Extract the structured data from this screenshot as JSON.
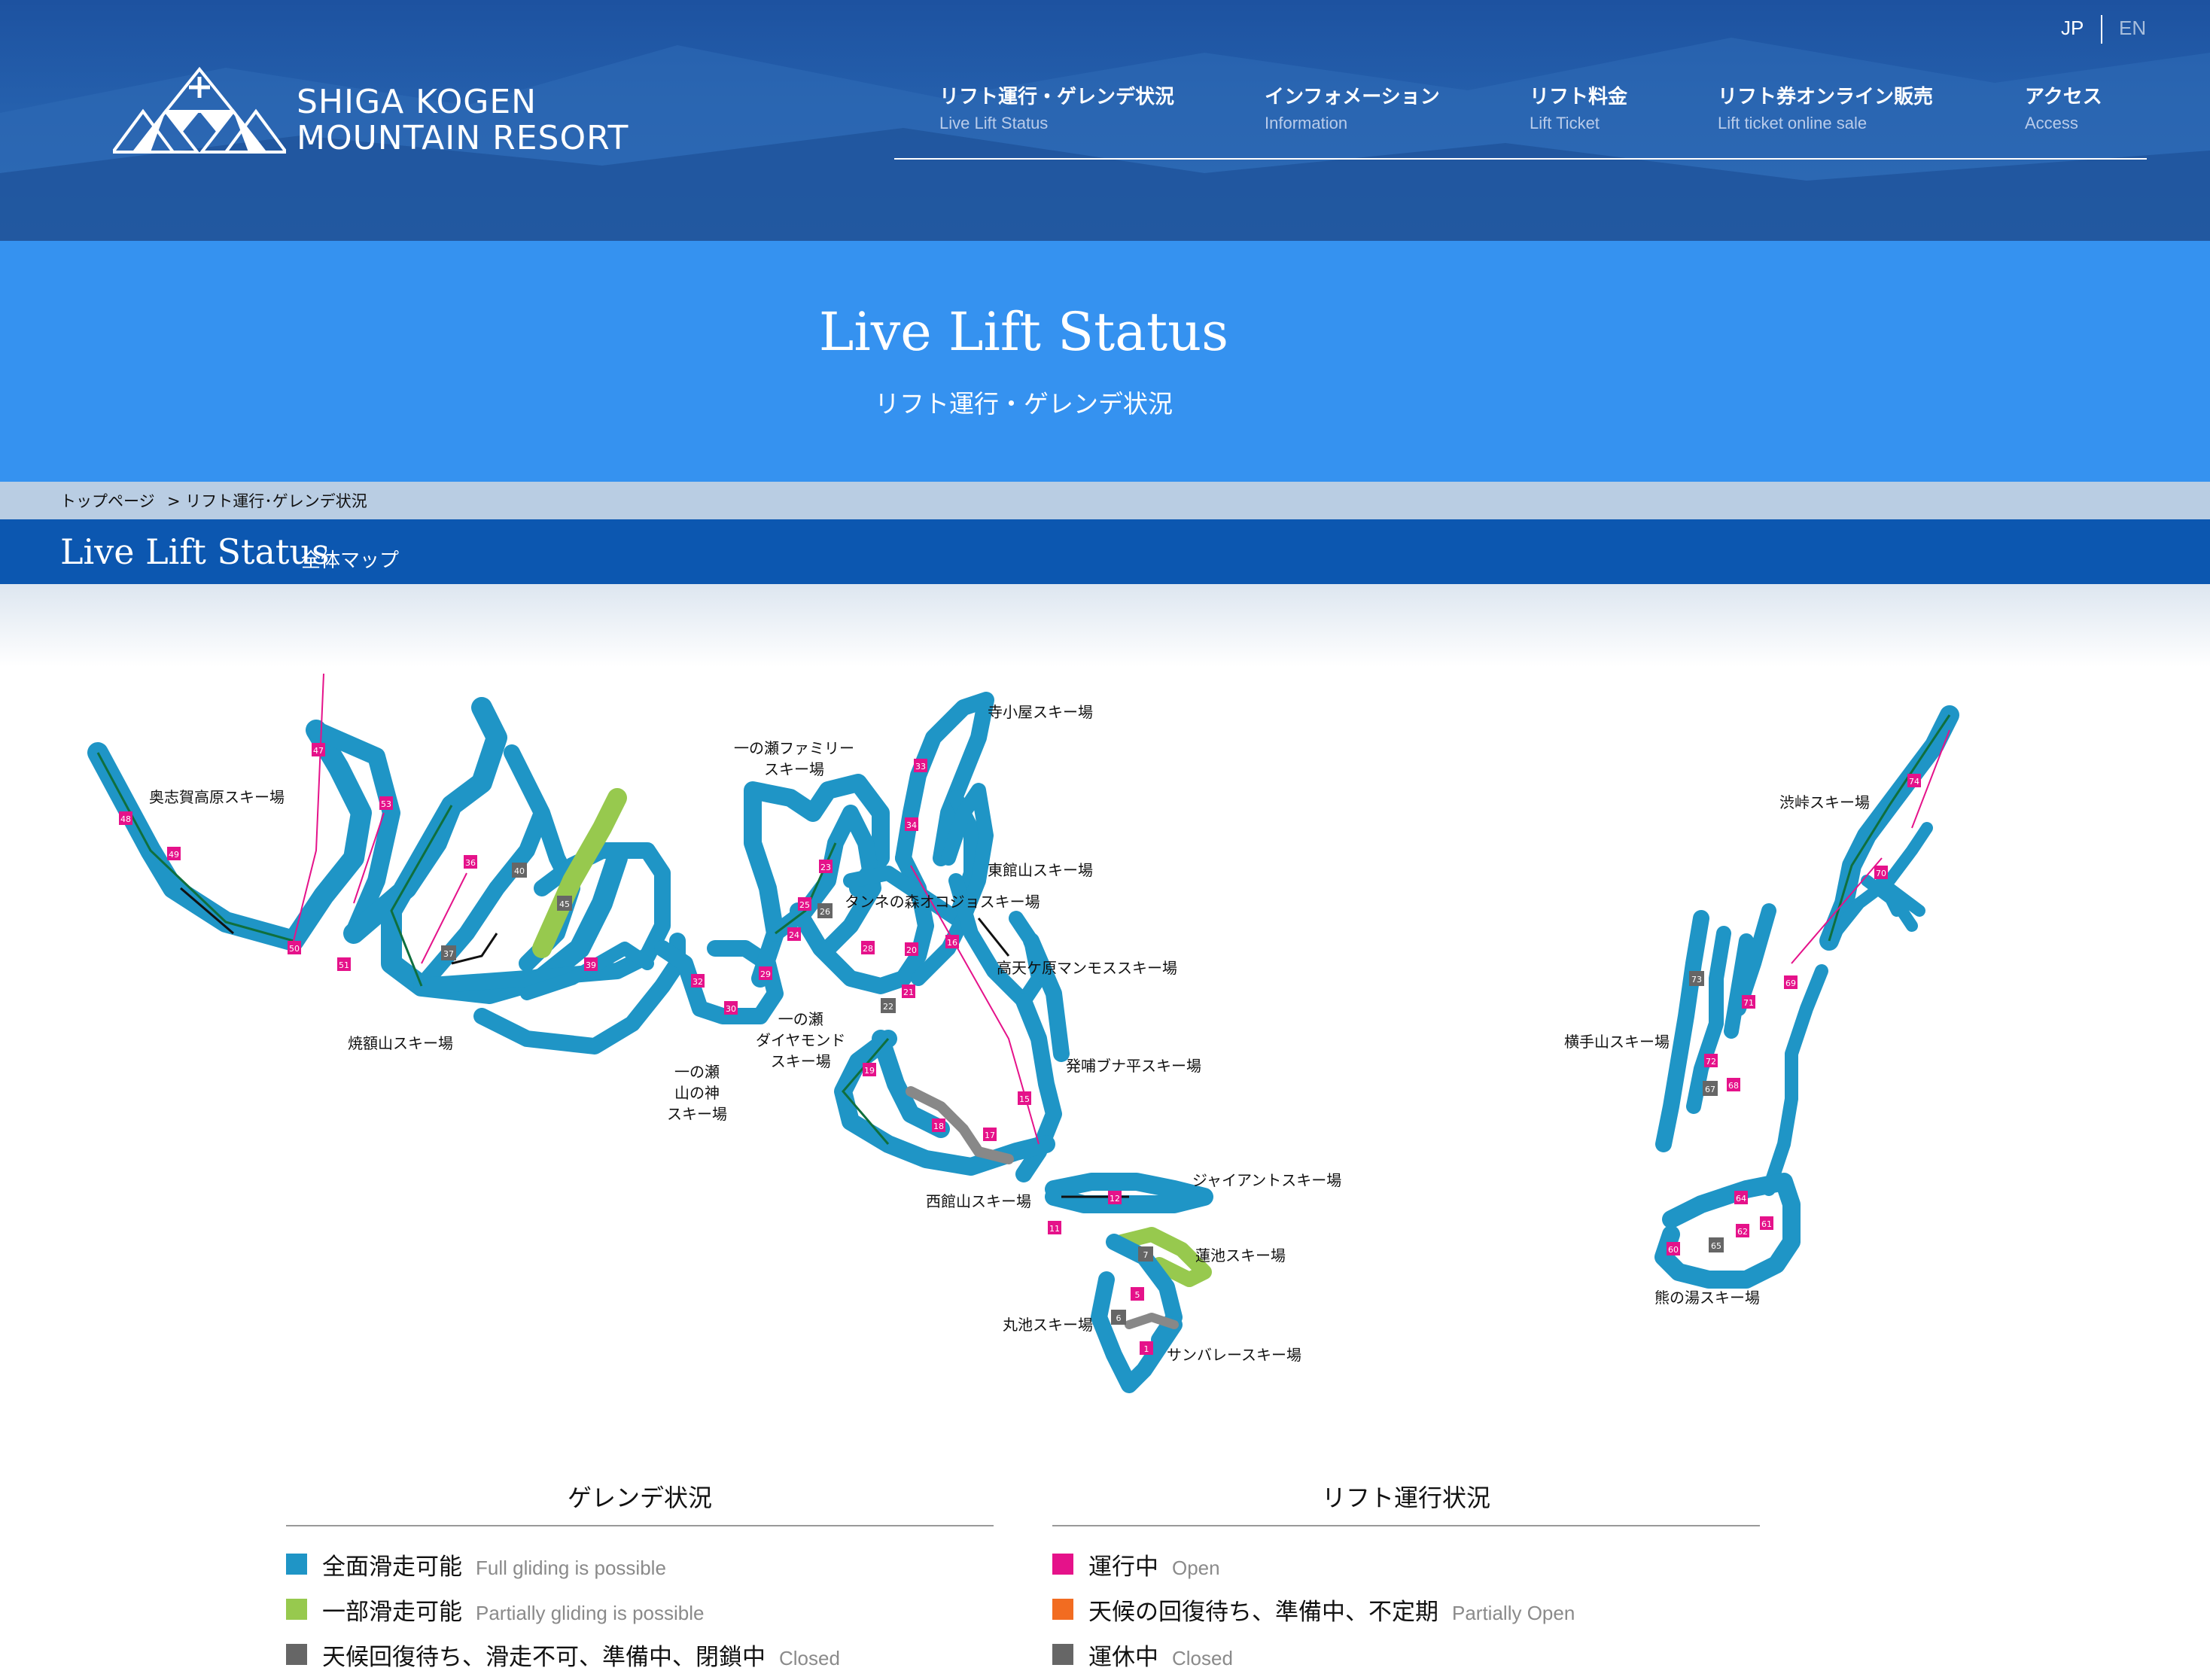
{
  "header": {
    "logo_line1": "SHIGA KOGEN",
    "logo_line2": "MOUNTAIN RESORT",
    "lang_jp": "JP",
    "lang_en": "EN",
    "nav": [
      {
        "jp": "リフト運行・ゲレンデ状況",
        "en": "Live Lift Status"
      },
      {
        "jp": "インフォメーション",
        "en": "Information"
      },
      {
        "jp": "リフト料金",
        "en": "Lift Ticket"
      },
      {
        "jp": "リフト券オンライン販売",
        "en": "Lift ticket online sale"
      },
      {
        "jp": "アクセス",
        "en": "Access"
      }
    ]
  },
  "hero": {
    "title": "Live Lift Status",
    "subtitle": "リフト運行・ゲレンデ状況"
  },
  "breadcrumb": {
    "home": "トップページ",
    "current": "> リフト運行･ゲレンデ状況"
  },
  "section": {
    "title": "Live Lift Status",
    "subtitle": "全体マップ"
  },
  "map": {
    "resorts": [
      {
        "lines": [
          "奥志賀高原スキー場"
        ]
      },
      {
        "lines": [
          "焼額山スキー場"
        ]
      },
      {
        "lines": [
          "一の瀬",
          "山の神",
          "スキー場"
        ]
      },
      {
        "lines": [
          "一の瀬",
          "ダイヤモンド",
          "スキー場"
        ]
      },
      {
        "lines": [
          "一の瀬ファミリー",
          "スキー場"
        ]
      },
      {
        "lines": [
          "寺小屋スキー場"
        ]
      },
      {
        "lines": [
          "東館山スキー場"
        ]
      },
      {
        "lines": [
          "タンネの森オコジョスキー場"
        ]
      },
      {
        "lines": [
          "高天ケ原マンモススキー場"
        ]
      },
      {
        "lines": [
          "発哺ブナ平スキー場"
        ]
      },
      {
        "lines": [
          "西館山スキー場"
        ]
      },
      {
        "lines": [
          "ジャイアントスキー場"
        ]
      },
      {
        "lines": [
          "蓮池スキー場"
        ]
      },
      {
        "lines": [
          "丸池スキー場"
        ]
      },
      {
        "lines": [
          "サンバレースキー場"
        ]
      },
      {
        "lines": [
          "渋峠スキー場"
        ]
      },
      {
        "lines": [
          "横手山スキー場"
        ]
      },
      {
        "lines": [
          "熊の湯スキー場"
        ]
      }
    ],
    "lifts_open": [
      "47",
      "53",
      "48",
      "49",
      "50",
      "51",
      "36",
      "39",
      "32",
      "30",
      "29",
      "33",
      "34",
      "23",
      "25",
      "24",
      "28",
      "20",
      "21",
      "16",
      "19",
      "18",
      "17",
      "15",
      "12",
      "11",
      "5",
      "1",
      "74",
      "70",
      "69",
      "71",
      "72",
      "68",
      "64",
      "61",
      "62",
      "60"
    ],
    "lifts_closed": [
      "40",
      "45",
      "37",
      "26",
      "22",
      "7",
      "6",
      "73",
      "67",
      "65"
    ],
    "colors": {
      "full_gliding": "#1f95c6",
      "partial_gliding": "#97c94e",
      "closed_slope": "#666666",
      "lift_open": "#e5128a",
      "lift_partial": "#f26c21",
      "lift_closed": "#666666"
    }
  },
  "legend": {
    "slope": {
      "title": "ゲレンデ状況",
      "items": [
        {
          "jp": "全面滑走可能",
          "en": "Full gliding is possible"
        },
        {
          "jp": "一部滑走可能",
          "en": "Partially gliding is possible"
        },
        {
          "jp": "天候回復待ち、滑走不可、準備中、閉鎖中",
          "en": "Closed"
        }
      ]
    },
    "lift": {
      "title": "リフト運行状況",
      "items": [
        {
          "jp": "運行中",
          "en": "Open"
        },
        {
          "jp": "天候の回復待ち、準備中、不定期",
          "en": "Partially Open"
        },
        {
          "jp": "運休中",
          "en": "Closed"
        }
      ]
    }
  }
}
